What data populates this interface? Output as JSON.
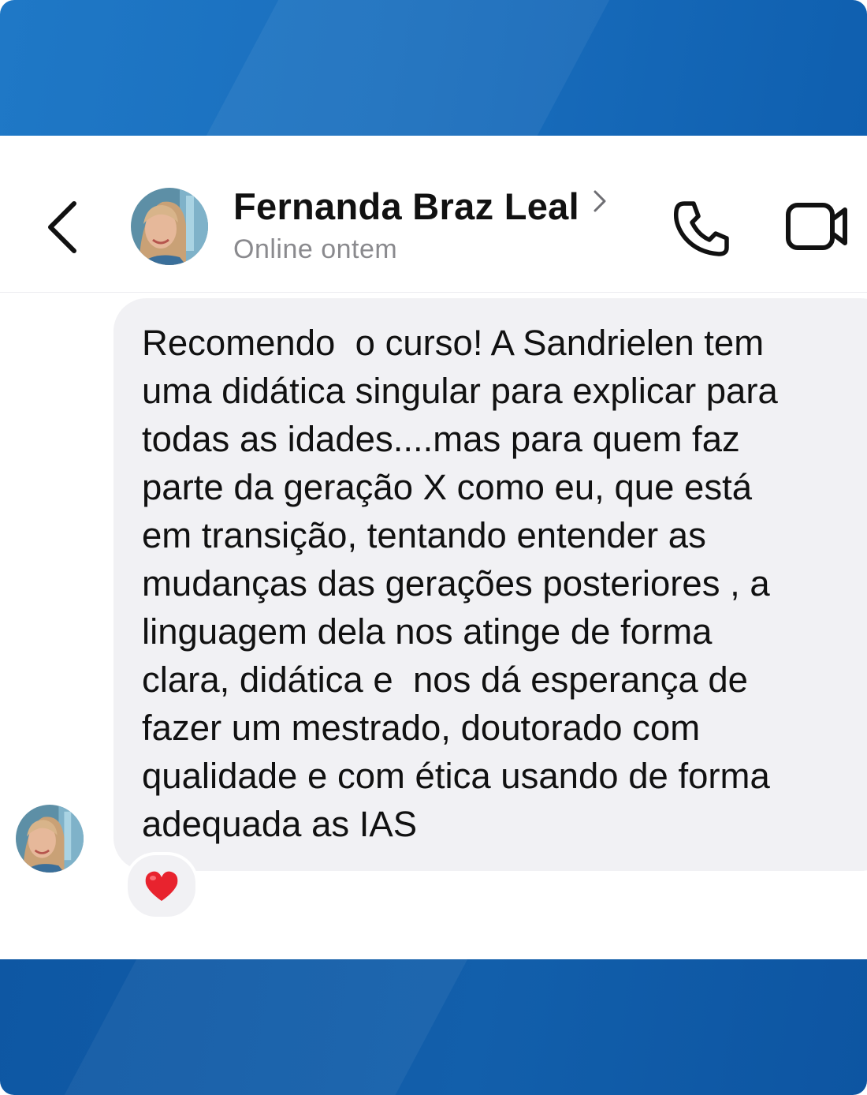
{
  "header": {
    "contact_name": "Fernanda Braz Leal",
    "status": "Online ontem"
  },
  "icons": {
    "back": "chevron-left-icon",
    "profile_chevron": "chevron-right-icon",
    "call": "phone-icon",
    "video": "video-camera-icon",
    "reaction": "red-heart-icon"
  },
  "message": {
    "lines": [
      "Recomendo  o curso! A Sandrielen tem",
      "uma didática singular para explicar para",
      "todas as idades....mas para quem faz",
      "parte da geração X como eu, que está",
      "em transição, tentando entender as",
      "mudanças das gerações posteriores , a",
      "linguagem dela nos atinge de forma",
      "clara, didática e  nos dá esperança de",
      "fazer um mestrado, doutorado com",
      "qualidade e com ética usando de forma",
      "adequada as IAS"
    ],
    "reaction": "❤️"
  },
  "colors": {
    "band_blue": "#1a6fbe",
    "bubble": "#f1f1f4",
    "text": "#111111",
    "status_gray": "#8a8a8e",
    "heart": "#e8232e"
  }
}
